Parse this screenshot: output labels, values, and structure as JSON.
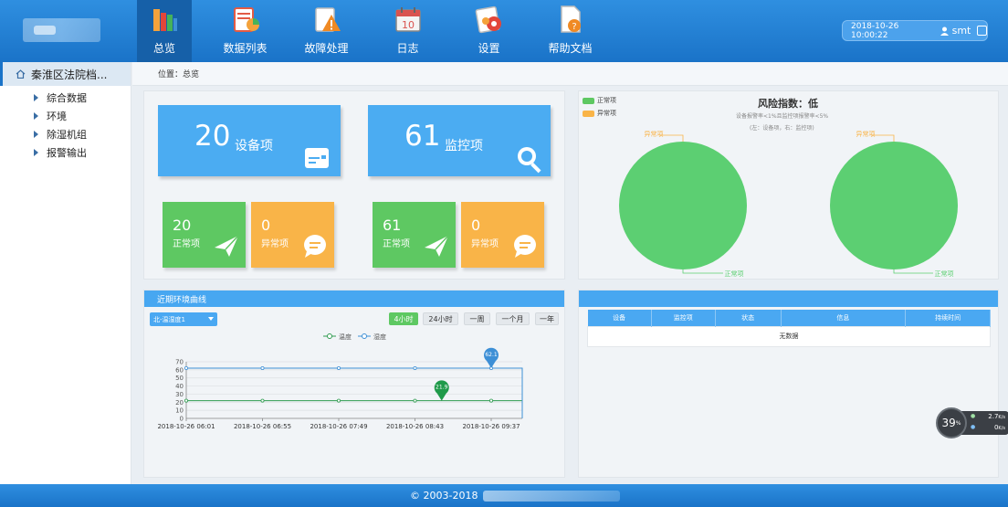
{
  "colors": {
    "brand_blue": "#1a73c8",
    "card_blue": "#4bacf2",
    "normal_green": "#5ec862",
    "abnormal_orange": "#f9b448",
    "pie_green": "#5ccf72"
  },
  "header": {
    "nav": [
      {
        "label": "总览",
        "icon": "books-icon",
        "active": true
      },
      {
        "label": "数据列表",
        "icon": "data-list-icon"
      },
      {
        "label": "故障处理",
        "icon": "warning-icon"
      },
      {
        "label": "日志",
        "icon": "calendar-icon"
      },
      {
        "label": "设置",
        "icon": "gear-icon"
      },
      {
        "label": "帮助文档",
        "icon": "help-doc-icon"
      }
    ],
    "datetime": "2018-10-26 10:00:22",
    "username": "smt"
  },
  "sidebar": {
    "title": "秦淮区法院档...",
    "items": [
      {
        "label": "综合数据"
      },
      {
        "label": "环境"
      },
      {
        "label": "除湿机组"
      },
      {
        "label": "报警输出"
      }
    ]
  },
  "breadcrumb": "位置：总览",
  "stats": {
    "device_total": {
      "value": "20",
      "label": "设备项"
    },
    "monitor_total": {
      "value": "61",
      "label": "监控项"
    },
    "device_normal": {
      "value": "20",
      "label": "正常项"
    },
    "device_abnormal": {
      "value": "0",
      "label": "异常项"
    },
    "monitor_normal": {
      "value": "61",
      "label": "正常项"
    },
    "monitor_abnormal": {
      "value": "0",
      "label": "异常项"
    }
  },
  "risk": {
    "legend": [
      "正常项",
      "异常项"
    ],
    "title": "风险指数：低",
    "subtitle": "设备报警率<1%且监控项报警率<5%",
    "subtitle2": "(左：设备项，右：监控项)",
    "pies": [
      {
        "normal_label": "正常项",
        "abnormal_label": "异常项",
        "normal": 20,
        "abnormal": 0
      },
      {
        "normal_label": "正常项",
        "abnormal_label": "异常项",
        "normal": 61,
        "abnormal": 0
      }
    ]
  },
  "env": {
    "title": "近期环境曲线",
    "selector": "北-温湿度1",
    "ranges": [
      {
        "label": "4小时",
        "active": true
      },
      {
        "label": "24小时"
      },
      {
        "label": "一周"
      },
      {
        "label": "一个月"
      },
      {
        "label": "一年"
      }
    ]
  },
  "chart_data": {
    "type": "line",
    "legend": [
      "温度",
      "湿度"
    ],
    "x_ticks": [
      "2018-10-26 06:01",
      "2018-10-26 06:55",
      "2018-10-26 07:49",
      "2018-10-26 08:43",
      "2018-10-26 09:37"
    ],
    "y_ticks": [
      0,
      10,
      20,
      30,
      40,
      50,
      60,
      70
    ],
    "ylim": [
      0,
      70
    ],
    "series": [
      {
        "name": "温度",
        "color": "#2e9a4f",
        "values": [
          21.9,
          21.9,
          21.9,
          21.9,
          21.9
        ],
        "last": 21.9
      },
      {
        "name": "湿度",
        "color": "#3d8fd6",
        "values": [
          62.1,
          62.1,
          62.1,
          62.1,
          62.1
        ],
        "last": 62.1
      }
    ],
    "markers": [
      {
        "series": "温度",
        "label": "21.9",
        "x_index": 3.35,
        "value": 21.9,
        "color": "#1f9a4a"
      },
      {
        "series": "湿度",
        "label": "62.1",
        "x_index": 4.0,
        "value": 62.1,
        "color": "#3d8fd6"
      }
    ],
    "grid": true
  },
  "alarm": {
    "columns": [
      "设备",
      "监控项",
      "状态",
      "信息",
      "持续时间"
    ],
    "empty": "无数据"
  },
  "gauge": {
    "value": "39",
    "unit": "%",
    "up": "2.7",
    "down": "0",
    "rate_unit": "K/s"
  },
  "footer": {
    "copyright": "© 2003-2018"
  }
}
